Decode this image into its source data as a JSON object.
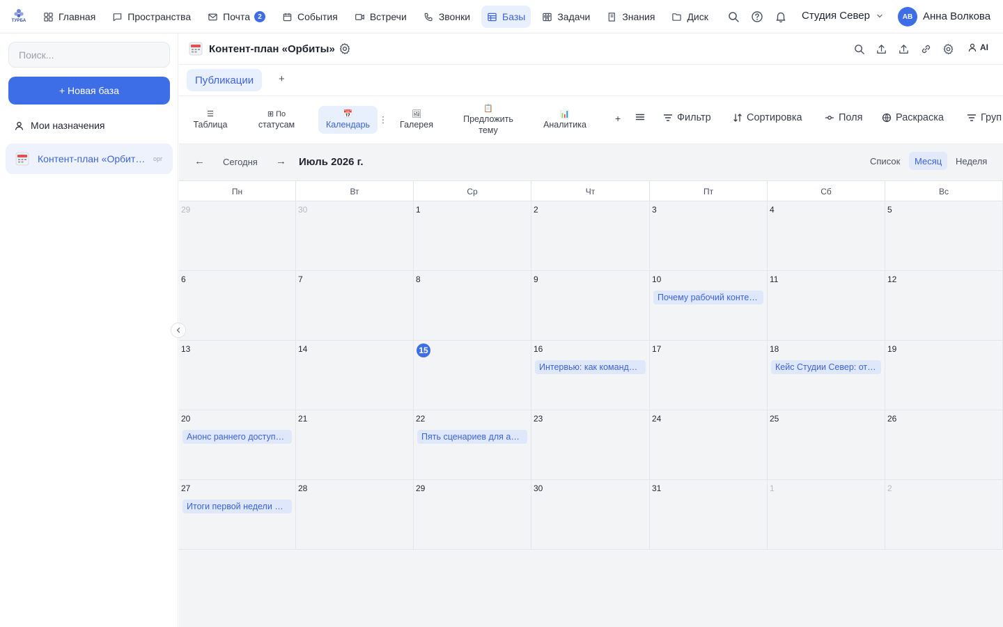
{
  "brand": {
    "logo_text": "ТУРБА",
    "accent": "#3d6ee8"
  },
  "nav": {
    "items": [
      {
        "label": "Главная",
        "icon": "grid-icon"
      },
      {
        "label": "Пространства",
        "icon": "chat-icon"
      },
      {
        "label": "Почта",
        "icon": "mail-icon",
        "badge": "2"
      },
      {
        "label": "События",
        "icon": "calendar-icon"
      },
      {
        "label": "Встречи",
        "icon": "video-icon"
      },
      {
        "label": "Звонки",
        "icon": "phone-icon"
      },
      {
        "label": "Базы",
        "icon": "table-icon",
        "active": true
      },
      {
        "label": "Задачи",
        "icon": "kanban-icon"
      },
      {
        "label": "Знания",
        "icon": "book-icon"
      },
      {
        "label": "Диск",
        "icon": "folder-icon"
      }
    ],
    "workspace": "Студия Север",
    "user_initials": "АВ",
    "user_name": "Анна Волкова"
  },
  "sidebar": {
    "search_placeholder": "Поиск...",
    "new_base_label": "+ Новая база",
    "my_assignments": "Мои назначения",
    "base_item_label": "Контент-план «Орбиты»",
    "base_item_tag": "орг"
  },
  "header": {
    "title": "Контент-план «Орбиты»",
    "ai_label": "AI",
    "tab_label": "Публикации",
    "add_tab": "+"
  },
  "views": [
    {
      "icon": "☰",
      "label": "Таблица"
    },
    {
      "icon": "⊞ По",
      "label": "статусам"
    },
    {
      "icon": "📅",
      "label": "Календарь",
      "active": true
    },
    {
      "icon": "🖼",
      "label": "Галерея"
    },
    {
      "icon": "📋",
      "label": "Предложить тему"
    },
    {
      "icon": "📊",
      "label": "Аналитика"
    }
  ],
  "toolbar": {
    "add_view": "+",
    "filter": "Фильтр",
    "sort": "Сортировка",
    "fields": "Поля",
    "coloring": "Раскраска",
    "group": "Груп"
  },
  "calendar": {
    "prev": "←",
    "today": "Сегодня",
    "next": "→",
    "month": "Июль 2026 г.",
    "modes": [
      "Список",
      "Месяц",
      "Неделя"
    ],
    "active_mode": "Месяц",
    "weekdays": [
      "Пн",
      "Вт",
      "Ср",
      "Чт",
      "Пт",
      "Сб",
      "Вс"
    ],
    "weeks": [
      [
        {
          "d": "29",
          "muted": true
        },
        {
          "d": "30",
          "muted": true
        },
        {
          "d": "1"
        },
        {
          "d": "2"
        },
        {
          "d": "3"
        },
        {
          "d": "4"
        },
        {
          "d": "5"
        }
      ],
      [
        {
          "d": "6"
        },
        {
          "d": "7"
        },
        {
          "d": "8"
        },
        {
          "d": "9"
        },
        {
          "d": "10",
          "event": "Почему рабочий контент ломается"
        },
        {
          "d": "11"
        },
        {
          "d": "12"
        }
      ],
      [
        {
          "d": "13"
        },
        {
          "d": "14"
        },
        {
          "d": "15",
          "today": true
        },
        {
          "d": "16",
          "event": "Интервью: как команда Орбиты"
        },
        {
          "d": "17"
        },
        {
          "d": "18",
          "event": "Кейс Студии Север: от хаоса"
        },
        {
          "d": "19"
        }
      ],
      [
        {
          "d": "20",
          "event": "Анонс раннего доступа Орбиты"
        },
        {
          "d": "21"
        },
        {
          "d": "22",
          "event": "Пять сценариев для автоматизации"
        },
        {
          "d": "23"
        },
        {
          "d": "24"
        },
        {
          "d": "25"
        },
        {
          "d": "26"
        }
      ],
      [
        {
          "d": "27",
          "event": "Итоги первой недели релиза"
        },
        {
          "d": "28"
        },
        {
          "d": "29"
        },
        {
          "d": "30"
        },
        {
          "d": "31"
        },
        {
          "d": "1",
          "muted": true
        },
        {
          "d": "2",
          "muted": true
        }
      ]
    ]
  }
}
